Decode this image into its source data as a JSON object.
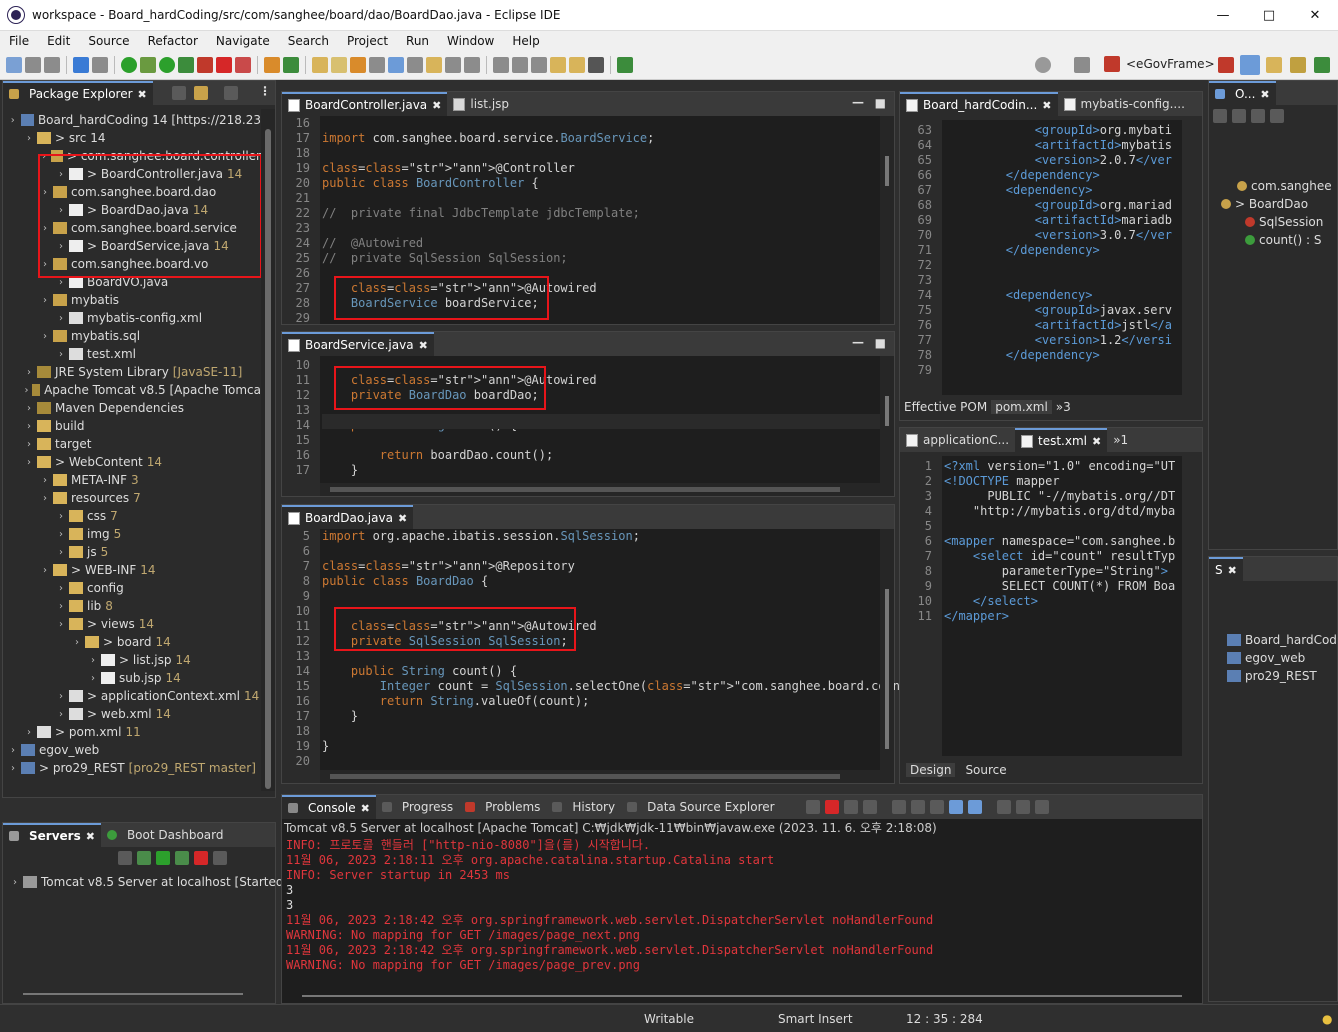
{
  "window": {
    "title": "workspace - Board_hardCoding/src/com/sanghee/board/dao/BoardDao.java - Eclipse IDE"
  },
  "menu": [
    "File",
    "Edit",
    "Source",
    "Refactor",
    "Navigate",
    "Search",
    "Project",
    "Run",
    "Window",
    "Help"
  ],
  "toolbar": {
    "perspective": "<eGovFrame>"
  },
  "package_explorer": {
    "tab": "Package Explorer",
    "rows": [
      {
        "text": "Board_hardCoding 14 [https://218.23",
        "deco": ""
      },
      {
        "text": "> src 14",
        "deco": ""
      },
      {
        "text": "> com.sanghee.board.controller",
        "deco": ""
      },
      {
        "text": "> BoardController.java",
        "deco": "14"
      },
      {
        "text": "com.sanghee.board.dao",
        "deco": ""
      },
      {
        "text": "> BoardDao.java",
        "deco": "14"
      },
      {
        "text": "com.sanghee.board.service",
        "deco": ""
      },
      {
        "text": "> BoardService.java",
        "deco": "14"
      },
      {
        "text": "com.sanghee.board.vo",
        "deco": ""
      },
      {
        "text": "BoardVO.java",
        "deco": ""
      },
      {
        "text": "mybatis",
        "deco": ""
      },
      {
        "text": "mybatis-config.xml",
        "deco": ""
      },
      {
        "text": "mybatis.sql",
        "deco": ""
      },
      {
        "text": "test.xml",
        "deco": ""
      },
      {
        "text": "JRE System Library",
        "deco": "[JavaSE-11]"
      },
      {
        "text": "Apache Tomcat v8.5 [Apache Tomca",
        "deco": ""
      },
      {
        "text": "Maven Dependencies",
        "deco": ""
      },
      {
        "text": "build",
        "deco": ""
      },
      {
        "text": "target",
        "deco": ""
      },
      {
        "text": "> WebContent",
        "deco": "14"
      },
      {
        "text": "META-INF",
        "deco": "3"
      },
      {
        "text": "resources",
        "deco": "7"
      },
      {
        "text": "css",
        "deco": "7"
      },
      {
        "text": "img",
        "deco": "5"
      },
      {
        "text": "js",
        "deco": "5"
      },
      {
        "text": "> WEB-INF",
        "deco": "14"
      },
      {
        "text": "config",
        "deco": ""
      },
      {
        "text": "lib",
        "deco": "8"
      },
      {
        "text": "> views",
        "deco": "14"
      },
      {
        "text": "> board",
        "deco": "14"
      },
      {
        "text": "> list.jsp",
        "deco": "14"
      },
      {
        "text": "sub.jsp",
        "deco": "14"
      },
      {
        "text": "> applicationContext.xml",
        "deco": "14"
      },
      {
        "text": "> web.xml",
        "deco": "14"
      },
      {
        "text": "> pom.xml",
        "deco": "11"
      },
      {
        "text": "egov_web",
        "deco": ""
      },
      {
        "text": "> pro29_REST",
        "deco": "[pro29_REST master]"
      }
    ]
  },
  "servers": {
    "tab": "Servers",
    "tab2": "Boot Dashboard",
    "item": "Tomcat v8.5 Server at localhost  [Started, F"
  },
  "editor1": {
    "tabs": [
      "BoardController.java",
      "list.jsp"
    ],
    "lines": [
      "16",
      "17",
      "18",
      "19",
      "20",
      "21",
      "22",
      "23",
      "24",
      "25",
      "26",
      "27",
      "28",
      "29"
    ],
    "code": [
      "",
      "import com.sanghee.board.service.BoardService;",
      "",
      "@Controller",
      "public class BoardController {",
      "",
      "//  private final JdbcTemplate jdbcTemplate;",
      "",
      "//  @Autowired",
      "//  private SqlSession SqlSession;",
      "",
      "    @Autowired",
      "    BoardService boardService;",
      ""
    ]
  },
  "editor2": {
    "tab": "BoardService.java",
    "lines": [
      "10",
      "11",
      "12",
      "13",
      "14",
      "15",
      "16",
      "17"
    ],
    "code": [
      "",
      "    @Autowired",
      "    private BoardDao boardDao;",
      "",
      "    public String count() {",
      "",
      "        return boardDao.count();",
      "    }"
    ]
  },
  "editor3": {
    "tab": "BoardDao.java",
    "lines": [
      "5",
      "6",
      "7",
      "8",
      "9",
      "10",
      "11",
      "12",
      "13",
      "14",
      "15",
      "16",
      "17",
      "18",
      "19",
      "20"
    ],
    "code": [
      "import org.apache.ibatis.session.SqlSession;",
      "",
      "@Repository",
      "public class BoardDao {",
      "",
      "",
      "    @Autowired",
      "    private SqlSession SqlSession;",
      "",
      "    public String count() {",
      "        Integer count = SqlSession.selectOne(\"com.sanghee.board.count\");",
      "        return String.valueOf(count);",
      "    }",
      "",
      "}",
      ""
    ]
  },
  "pom_editor": {
    "tabs": [
      "Board_hardCodin...",
      "mybatis-config...."
    ],
    "bottom_tabs": [
      "Effective POM",
      "pom.xml",
      "»3"
    ],
    "lines": [
      "63",
      "64",
      "65",
      "66",
      "67",
      "68",
      "69",
      "70",
      "71",
      "72",
      "73",
      "74",
      "75",
      "76",
      "77",
      "78",
      "79"
    ],
    "code": [
      "            <groupId>org.mybati",
      "            <artifactId>mybatis",
      "            <version>2.0.7</ver",
      "        </dependency>",
      "        <dependency>",
      "            <groupId>org.mariad",
      "            <artifactId>mariadb",
      "            <version>3.0.7</ver",
      "        </dependency>",
      "",
      "",
      "        <dependency>",
      "            <groupId>javax.serv",
      "            <artifactId>jstl</a",
      "            <version>1.2</versi",
      "        </dependency>",
      ""
    ]
  },
  "xml_editor": {
    "tabs": [
      "applicationC...",
      "test.xml",
      "»1"
    ],
    "bottom_tabs": [
      "Design",
      "Source"
    ],
    "lines": [
      "1",
      "2",
      "3",
      "4",
      "5",
      "6",
      "7",
      "8",
      "9",
      "10",
      "11"
    ],
    "code": [
      "<?xml version=\"1.0\" encoding=\"UT",
      "<!DOCTYPE mapper",
      "      PUBLIC \"-//mybatis.org//DT",
      "    \"http://mybatis.org/dtd/myba",
      "",
      "<mapper namespace=\"com.sanghee.b",
      "    <select id=\"count\" resultTyp",
      "        parameterType=\"String\">",
      "        SELECT COUNT(*) FROM Boa",
      "    </select>",
      "</mapper>"
    ]
  },
  "outline": {
    "tab": "O...",
    "rows": [
      "com.sanghee",
      "> BoardDao",
      "SqlSession",
      "count() : S"
    ]
  },
  "project_mini": {
    "tab": "S",
    "rows": [
      "Board_hardCodi",
      "egov_web",
      "pro29_REST"
    ]
  },
  "console": {
    "tabs": [
      "Console",
      "Progress",
      "Problems",
      "History",
      "Data Source Explorer"
    ],
    "title": "Tomcat v8.5 Server at localhost [Apache Tomcat] C:₩jdk₩jdk-11₩bin₩javaw.exe  (2023. 11. 6. 오후 2:18:08)",
    "lines": [
      {
        "text": "INFO: 프로토콜 핸들러 [\"http-nio-8080\"]을(를) 시작합니다.",
        "color": "red"
      },
      {
        "text": "11월 06, 2023 2:18:11 오후 org.apache.catalina.startup.Catalina start",
        "color": "red"
      },
      {
        "text": "INFO: Server startup in 2453 ms",
        "color": "red"
      },
      {
        "text": "3",
        "color": "white"
      },
      {
        "text": "3",
        "color": "white"
      },
      {
        "text": "11월 06, 2023 2:18:42 오후 org.springframework.web.servlet.DispatcherServlet noHandlerFound",
        "color": "red"
      },
      {
        "text": "WARNING: No mapping for GET /images/page_next.png",
        "color": "red"
      },
      {
        "text": "11월 06, 2023 2:18:42 오후 org.springframework.web.servlet.DispatcherServlet noHandlerFound",
        "color": "red"
      },
      {
        "text": "WARNING: No mapping for GET /images/page_prev.png",
        "color": "red"
      }
    ]
  },
  "status": {
    "writable": "Writable",
    "insert": "Smart Insert",
    "position": "12 : 35 : 284"
  }
}
